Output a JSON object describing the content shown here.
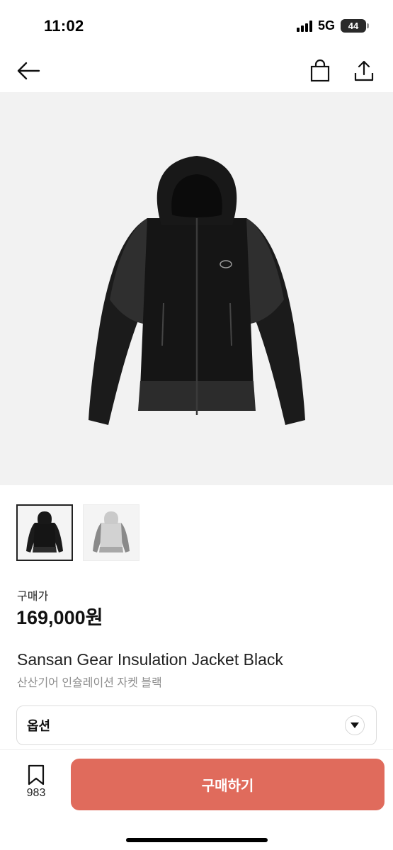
{
  "status_bar": {
    "time": "11:02",
    "network": "5G",
    "battery": "44",
    "icons": [
      "signal-icon",
      "battery-icon"
    ]
  },
  "nav": {
    "icons": [
      "back-arrow-icon",
      "shopping-bag-icon",
      "share-icon"
    ]
  },
  "product": {
    "price_label": "구매가",
    "price": "169,000원",
    "name_en": "Sansan Gear Insulation Jacket Black",
    "name_ko": "산산기어 인슐레이션 자켓 블랙",
    "thumbnails": [
      {
        "name": "black",
        "selected": true
      },
      {
        "name": "gray",
        "selected": false
      }
    ]
  },
  "option": {
    "label": "옵션",
    "icon": "chevron-down-icon"
  },
  "bottom": {
    "bookmark_count": "983",
    "buy_label": "구매하기",
    "icons": [
      "bookmark-icon"
    ]
  },
  "colors": {
    "accent": "#e06b5c",
    "image_bg": "#f2f2f2",
    "subtext": "#8e8e8e"
  }
}
